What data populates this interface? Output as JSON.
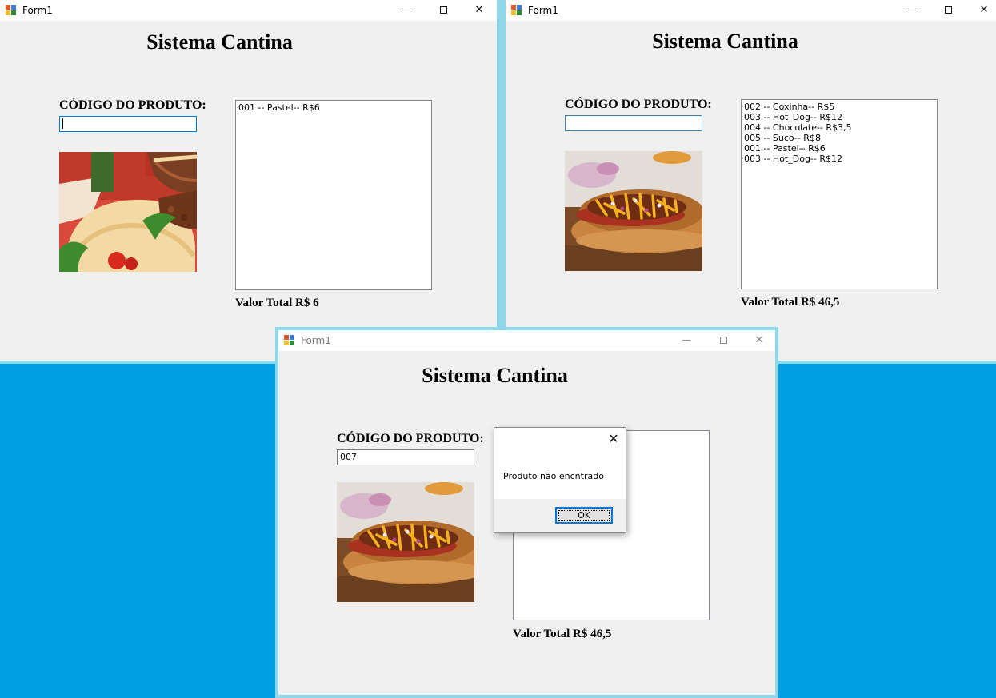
{
  "windows": [
    {
      "title": "Form1",
      "app_title": "Sistema Cantina",
      "code_label": "CÓDIGO DO PRODUTO:",
      "code_value": "",
      "image": "pastel",
      "list_items": [
        "001 -- Pastel-- R$6"
      ],
      "total": "Valor Total R$ 6"
    },
    {
      "title": "Form1",
      "app_title": "Sistema Cantina",
      "code_label": "CÓDIGO DO PRODUTO:",
      "code_value": "",
      "image": "hot-dog",
      "list_items": [
        "002 -- Coxinha-- R$5",
        "003 -- Hot_Dog-- R$12",
        "004 -- Chocolate-- R$3,5",
        "005 -- Suco-- R$8",
        "001 -- Pastel-- R$6",
        "003 -- Hot_Dog-- R$12"
      ],
      "total": "Valor Total R$ 46,5"
    },
    {
      "title": "Form1",
      "app_title": "Sistema Cantina",
      "code_label": "CÓDIGO DO PRODUTO:",
      "code_value": "007",
      "image": "hot-dog",
      "list_items": [],
      "total": "Valor Total R$ 46,5"
    }
  ],
  "dialog": {
    "message": "Produto não encntrado",
    "ok_label": "OK"
  },
  "colors": {
    "desktop": "#009fe3",
    "window_bg": "#f0f0f0",
    "window_border": "#8fd8ea",
    "focus_blue": "#0078d7"
  },
  "icons": {
    "window_controls": [
      "minimize-icon",
      "maximize-icon",
      "close-icon"
    ],
    "app": "winforms-app-icon"
  }
}
